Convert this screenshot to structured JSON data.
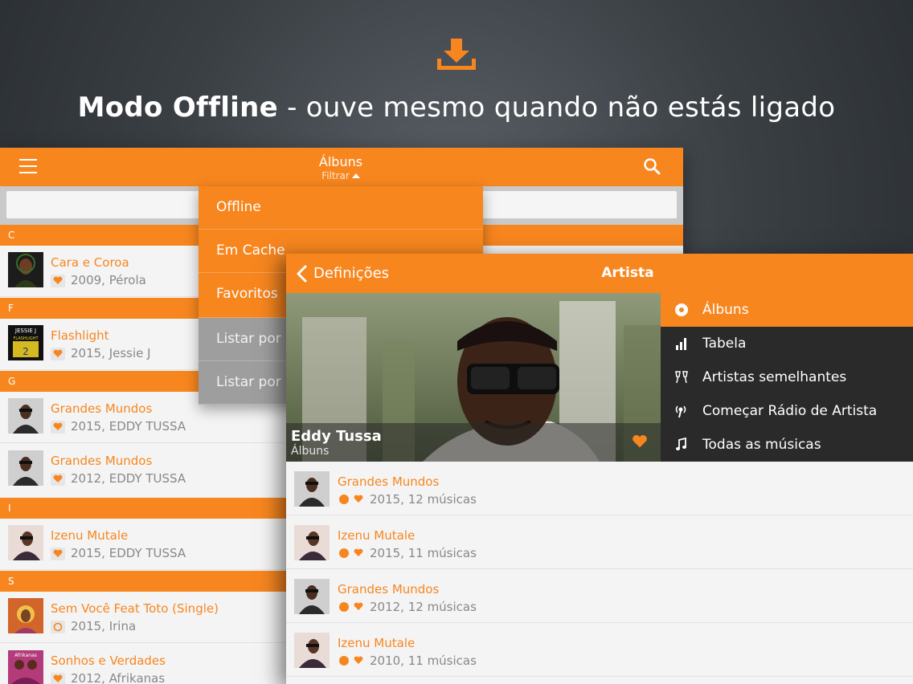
{
  "promo": {
    "icon": "download-icon",
    "title_bold": "Modo Offline",
    "title_rest": " - ouve mesmo quando não estás ligado"
  },
  "albums_window": {
    "title": "Álbuns",
    "subtitle": "Filtrar",
    "sections": [
      {
        "letter": "C",
        "rows": [
          {
            "title": "Cara e Coroa",
            "sub": "2009, Pérola",
            "status": "heart"
          }
        ]
      },
      {
        "letter": "F",
        "rows": [
          {
            "title": "Flashlight",
            "sub": "2015, Jessie J",
            "status": "heart"
          }
        ]
      },
      {
        "letter": "G",
        "rows": [
          {
            "title": "Grandes Mundos",
            "sub": "2015, EDDY TUSSA",
            "status": "heart"
          },
          {
            "title": "Grandes Mundos",
            "sub": "2012, EDDY TUSSA",
            "status": "heart"
          }
        ]
      },
      {
        "letter": "I",
        "rows": [
          {
            "title": "Izenu Mutale",
            "sub": "2015, EDDY TUSSA",
            "status": "heart"
          }
        ]
      },
      {
        "letter": "S",
        "rows": [
          {
            "title": "Sem Você Feat Toto (Single)",
            "sub": "2015, Irina",
            "status": "ring"
          },
          {
            "title": "Sonhos e Verdades",
            "sub": "2012, Afrikanas",
            "status": "heart"
          }
        ]
      }
    ]
  },
  "filter_menu": {
    "items": [
      "Offline",
      "Em Cache",
      "Favoritos",
      "Listar por l",
      "Listar por l"
    ]
  },
  "artist_window": {
    "back_label": "Definições",
    "title": "Artista",
    "artist_name": "Eddy Tussa",
    "artist_sub": "Álbuns",
    "menu": [
      {
        "label": "Álbuns",
        "icon": "disc-icon"
      },
      {
        "label": "Tabela",
        "icon": "bar-chart-icon"
      },
      {
        "label": "Artistas semelhantes",
        "icon": "cheers-icon"
      },
      {
        "label": "Começar Rádio de Artista",
        "icon": "radio-icon"
      },
      {
        "label": "Todas as músicas",
        "icon": "music-note-icon"
      }
    ],
    "albums": [
      {
        "title": "Grandes Mundos",
        "sub": "2015, 12 músicas"
      },
      {
        "title": "Izenu Mutale",
        "sub": "2015, 11 músicas"
      },
      {
        "title": "Grandes Mundos",
        "sub": "2012, 12 músicas"
      },
      {
        "title": "Izenu Mutale",
        "sub": "2010, 11 músicas"
      }
    ]
  },
  "colors": {
    "accent": "#f7861f",
    "menu_dark": "#2a2a2a",
    "inactive_menu": "#9e9e9e"
  }
}
